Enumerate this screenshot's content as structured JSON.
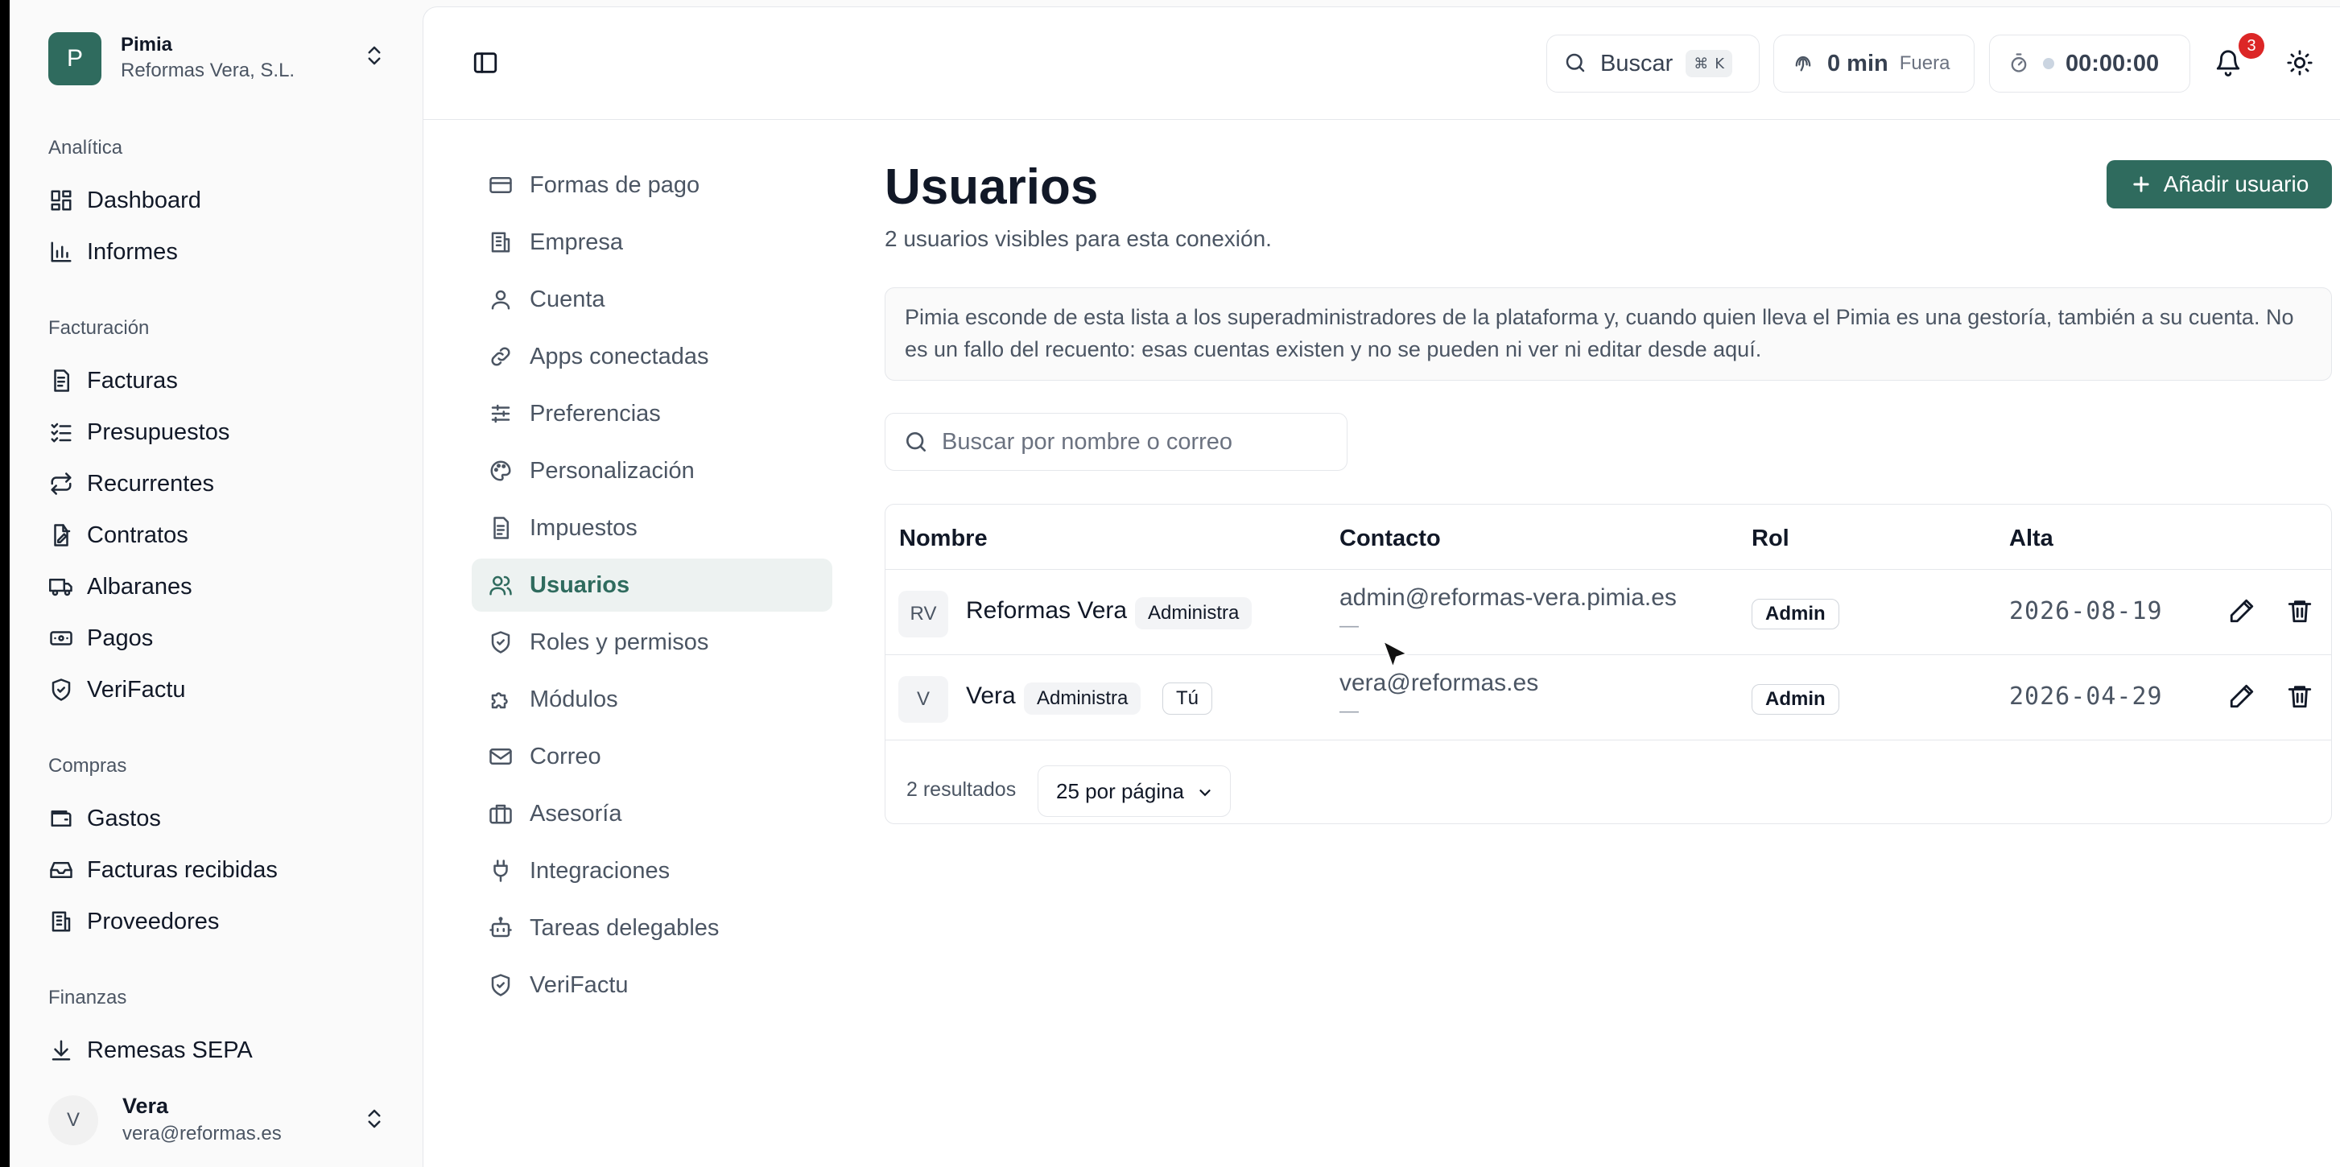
{
  "org": {
    "initial": "P",
    "name": "Pimia",
    "company": "Reformas Vera, S.L."
  },
  "sidebar": {
    "sections": [
      {
        "label": "Analítica",
        "items": [
          {
            "label": "Dashboard",
            "icon": "dashboard-icon"
          },
          {
            "label": "Informes",
            "icon": "bar-chart-icon"
          }
        ]
      },
      {
        "label": "Facturación",
        "items": [
          {
            "label": "Facturas",
            "icon": "invoice-icon"
          },
          {
            "label": "Presupuestos",
            "icon": "checklist-icon"
          },
          {
            "label": "Recurrentes",
            "icon": "repeat-icon"
          },
          {
            "label": "Contratos",
            "icon": "contract-icon"
          },
          {
            "label": "Albaranes",
            "icon": "truck-icon"
          },
          {
            "label": "Pagos",
            "icon": "banknote-icon"
          },
          {
            "label": "VeriFactu",
            "icon": "shield-check-icon"
          }
        ]
      },
      {
        "label": "Compras",
        "items": [
          {
            "label": "Gastos",
            "icon": "wallet-icon"
          },
          {
            "label": "Facturas recibidas",
            "icon": "inbox-icon"
          },
          {
            "label": "Proveedores",
            "icon": "building-icon"
          }
        ]
      },
      {
        "label": "Finanzas",
        "items": [
          {
            "label": "Remesas SEPA",
            "icon": "download-icon"
          }
        ]
      }
    ]
  },
  "current_user": {
    "initial": "V",
    "name": "Vera",
    "email": "vera@reformas.es"
  },
  "topbar": {
    "search_label": "Buscar",
    "search_shortcut_symbol": "⌘",
    "search_shortcut_key": "K",
    "fichaje_value": "0 min",
    "fichaje_status": "Fuera",
    "timer_value": "00:00:00",
    "notifications_count": "3"
  },
  "settings_nav": [
    {
      "label": "Formas de pago",
      "icon": "credit-card-icon",
      "active": false
    },
    {
      "label": "Empresa",
      "icon": "building-icon",
      "active": false
    },
    {
      "label": "Cuenta",
      "icon": "user-icon",
      "active": false
    },
    {
      "label": "Apps conectadas",
      "icon": "link-icon",
      "active": false
    },
    {
      "label": "Preferencias",
      "icon": "sliders-icon",
      "active": false
    },
    {
      "label": "Personalización",
      "icon": "palette-icon",
      "active": false
    },
    {
      "label": "Impuestos",
      "icon": "document-icon",
      "active": false
    },
    {
      "label": "Usuarios",
      "icon": "users-icon",
      "active": true
    },
    {
      "label": "Roles y permisos",
      "icon": "shield-icon",
      "active": false
    },
    {
      "label": "Módulos",
      "icon": "puzzle-icon",
      "active": false
    },
    {
      "label": "Correo",
      "icon": "mail-icon",
      "active": false
    },
    {
      "label": "Asesoría",
      "icon": "briefcase-icon",
      "active": false
    },
    {
      "label": "Integraciones",
      "icon": "plug-icon",
      "active": false
    },
    {
      "label": "Tareas delegables",
      "icon": "bot-icon",
      "active": false
    },
    {
      "label": "VeriFactu",
      "icon": "shield-check-icon",
      "active": false
    }
  ],
  "page": {
    "title": "Usuarios",
    "subtitle": "2 usuarios visibles para esta conexión.",
    "add_button": "Añadir usuario",
    "notice": "Pimia esconde de esta lista a los superadministradores de la plataforma y, cuando quien lleva el Pimia es una gestoría, también a su cuenta. No es un fallo del recuento: esas cuentas existen y no se pueden ni ver ni editar desde aquí.",
    "filter_placeholder": "Buscar por nombre o correo"
  },
  "table": {
    "headers": {
      "name": "Nombre",
      "contact": "Contacto",
      "role": "Rol",
      "created": "Alta"
    },
    "rows": [
      {
        "initials": "RV",
        "name": "Reformas Vera",
        "tags": [
          "Administra"
        ],
        "email": "admin@reformas-vera.pimia.es",
        "phone": "—",
        "role": "Admin",
        "created": "2026-08-19"
      },
      {
        "initials": "V",
        "name": "Vera",
        "tags": [
          "Administra",
          "Tú"
        ],
        "email": "vera@reformas.es",
        "phone": "—",
        "role": "Admin",
        "created": "2026-04-29"
      }
    ],
    "results_label": "2 resultados",
    "per_page": "25 por página"
  },
  "colors": {
    "accent": "#2f6b5e",
    "badge": "#dc2626",
    "active_bg": "#edf2f1"
  }
}
